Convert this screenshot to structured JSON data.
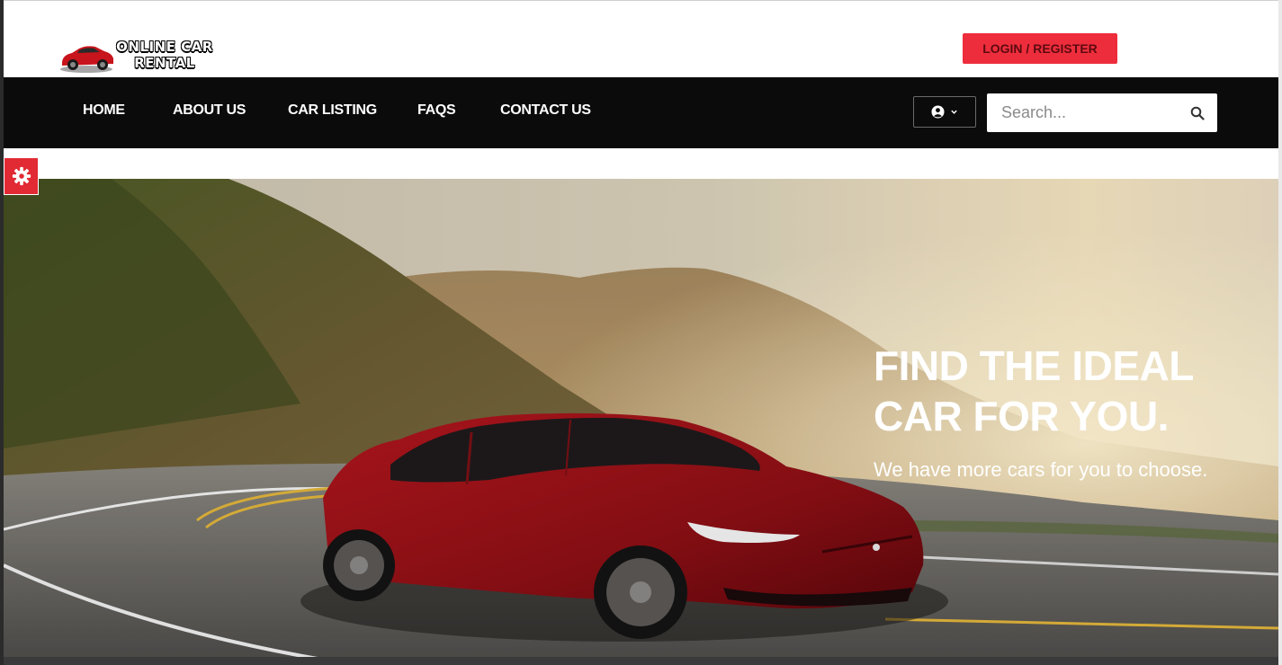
{
  "brand": {
    "logo_line1": "ONLINE CAR",
    "logo_line2": "RENTAL",
    "logo_text": "ONLINE CAR RENTAL"
  },
  "header": {
    "login_label": "LOGIN / REGISTER"
  },
  "nav": {
    "items": [
      {
        "label": "HOME"
      },
      {
        "label": "ABOUT US"
      },
      {
        "label": "CAR LISTING"
      },
      {
        "label": "FAQS"
      },
      {
        "label": "CONTACT US"
      }
    ],
    "user_icon": "user-circle-icon",
    "dropdown_icon": "chevron-down-icon"
  },
  "search": {
    "placeholder": "Search...",
    "icon": "search-icon"
  },
  "settings": {
    "icon": "gear-icon"
  },
  "hero": {
    "title_line1": "FIND THE IDEAL",
    "title_line2": "CAR FOR YOU.",
    "subtitle": "We have more cars for you to choose."
  },
  "colors": {
    "accent": "#ee2d3c",
    "navbar": "#0b0b0b",
    "car_red": "#9e1218"
  }
}
